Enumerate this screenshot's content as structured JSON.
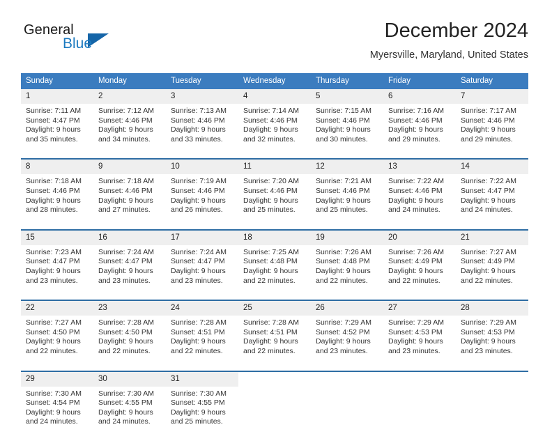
{
  "brand": {
    "name_part1": "General",
    "name_part2": "Blue",
    "logo_icon": "triangle-logo-icon",
    "accent_color": "#1c7ac0"
  },
  "header": {
    "title": "December 2024",
    "subtitle": "Myersville, Maryland, United States"
  },
  "calendar": {
    "header_color": "#3b7cbf",
    "row_border_color": "#2e6da4",
    "daynum_background": "#efefef",
    "weekdays": [
      "Sunday",
      "Monday",
      "Tuesday",
      "Wednesday",
      "Thursday",
      "Friday",
      "Saturday"
    ],
    "weeks": [
      [
        {
          "day": "1",
          "sunrise": "Sunrise: 7:11 AM",
          "sunset": "Sunset: 4:47 PM",
          "daylight1": "Daylight: 9 hours",
          "daylight2": "and 35 minutes."
        },
        {
          "day": "2",
          "sunrise": "Sunrise: 7:12 AM",
          "sunset": "Sunset: 4:46 PM",
          "daylight1": "Daylight: 9 hours",
          "daylight2": "and 34 minutes."
        },
        {
          "day": "3",
          "sunrise": "Sunrise: 7:13 AM",
          "sunset": "Sunset: 4:46 PM",
          "daylight1": "Daylight: 9 hours",
          "daylight2": "and 33 minutes."
        },
        {
          "day": "4",
          "sunrise": "Sunrise: 7:14 AM",
          "sunset": "Sunset: 4:46 PM",
          "daylight1": "Daylight: 9 hours",
          "daylight2": "and 32 minutes."
        },
        {
          "day": "5",
          "sunrise": "Sunrise: 7:15 AM",
          "sunset": "Sunset: 4:46 PM",
          "daylight1": "Daylight: 9 hours",
          "daylight2": "and 30 minutes."
        },
        {
          "day": "6",
          "sunrise": "Sunrise: 7:16 AM",
          "sunset": "Sunset: 4:46 PM",
          "daylight1": "Daylight: 9 hours",
          "daylight2": "and 29 minutes."
        },
        {
          "day": "7",
          "sunrise": "Sunrise: 7:17 AM",
          "sunset": "Sunset: 4:46 PM",
          "daylight1": "Daylight: 9 hours",
          "daylight2": "and 29 minutes."
        }
      ],
      [
        {
          "day": "8",
          "sunrise": "Sunrise: 7:18 AM",
          "sunset": "Sunset: 4:46 PM",
          "daylight1": "Daylight: 9 hours",
          "daylight2": "and 28 minutes."
        },
        {
          "day": "9",
          "sunrise": "Sunrise: 7:18 AM",
          "sunset": "Sunset: 4:46 PM",
          "daylight1": "Daylight: 9 hours",
          "daylight2": "and 27 minutes."
        },
        {
          "day": "10",
          "sunrise": "Sunrise: 7:19 AM",
          "sunset": "Sunset: 4:46 PM",
          "daylight1": "Daylight: 9 hours",
          "daylight2": "and 26 minutes."
        },
        {
          "day": "11",
          "sunrise": "Sunrise: 7:20 AM",
          "sunset": "Sunset: 4:46 PM",
          "daylight1": "Daylight: 9 hours",
          "daylight2": "and 25 minutes."
        },
        {
          "day": "12",
          "sunrise": "Sunrise: 7:21 AM",
          "sunset": "Sunset: 4:46 PM",
          "daylight1": "Daylight: 9 hours",
          "daylight2": "and 25 minutes."
        },
        {
          "day": "13",
          "sunrise": "Sunrise: 7:22 AM",
          "sunset": "Sunset: 4:46 PM",
          "daylight1": "Daylight: 9 hours",
          "daylight2": "and 24 minutes."
        },
        {
          "day": "14",
          "sunrise": "Sunrise: 7:22 AM",
          "sunset": "Sunset: 4:47 PM",
          "daylight1": "Daylight: 9 hours",
          "daylight2": "and 24 minutes."
        }
      ],
      [
        {
          "day": "15",
          "sunrise": "Sunrise: 7:23 AM",
          "sunset": "Sunset: 4:47 PM",
          "daylight1": "Daylight: 9 hours",
          "daylight2": "and 23 minutes."
        },
        {
          "day": "16",
          "sunrise": "Sunrise: 7:24 AM",
          "sunset": "Sunset: 4:47 PM",
          "daylight1": "Daylight: 9 hours",
          "daylight2": "and 23 minutes."
        },
        {
          "day": "17",
          "sunrise": "Sunrise: 7:24 AM",
          "sunset": "Sunset: 4:47 PM",
          "daylight1": "Daylight: 9 hours",
          "daylight2": "and 23 minutes."
        },
        {
          "day": "18",
          "sunrise": "Sunrise: 7:25 AM",
          "sunset": "Sunset: 4:48 PM",
          "daylight1": "Daylight: 9 hours",
          "daylight2": "and 22 minutes."
        },
        {
          "day": "19",
          "sunrise": "Sunrise: 7:26 AM",
          "sunset": "Sunset: 4:48 PM",
          "daylight1": "Daylight: 9 hours",
          "daylight2": "and 22 minutes."
        },
        {
          "day": "20",
          "sunrise": "Sunrise: 7:26 AM",
          "sunset": "Sunset: 4:49 PM",
          "daylight1": "Daylight: 9 hours",
          "daylight2": "and 22 minutes."
        },
        {
          "day": "21",
          "sunrise": "Sunrise: 7:27 AM",
          "sunset": "Sunset: 4:49 PM",
          "daylight1": "Daylight: 9 hours",
          "daylight2": "and 22 minutes."
        }
      ],
      [
        {
          "day": "22",
          "sunrise": "Sunrise: 7:27 AM",
          "sunset": "Sunset: 4:50 PM",
          "daylight1": "Daylight: 9 hours",
          "daylight2": "and 22 minutes."
        },
        {
          "day": "23",
          "sunrise": "Sunrise: 7:28 AM",
          "sunset": "Sunset: 4:50 PM",
          "daylight1": "Daylight: 9 hours",
          "daylight2": "and 22 minutes."
        },
        {
          "day": "24",
          "sunrise": "Sunrise: 7:28 AM",
          "sunset": "Sunset: 4:51 PM",
          "daylight1": "Daylight: 9 hours",
          "daylight2": "and 22 minutes."
        },
        {
          "day": "25",
          "sunrise": "Sunrise: 7:28 AM",
          "sunset": "Sunset: 4:51 PM",
          "daylight1": "Daylight: 9 hours",
          "daylight2": "and 22 minutes."
        },
        {
          "day": "26",
          "sunrise": "Sunrise: 7:29 AM",
          "sunset": "Sunset: 4:52 PM",
          "daylight1": "Daylight: 9 hours",
          "daylight2": "and 23 minutes."
        },
        {
          "day": "27",
          "sunrise": "Sunrise: 7:29 AM",
          "sunset": "Sunset: 4:53 PM",
          "daylight1": "Daylight: 9 hours",
          "daylight2": "and 23 minutes."
        },
        {
          "day": "28",
          "sunrise": "Sunrise: 7:29 AM",
          "sunset": "Sunset: 4:53 PM",
          "daylight1": "Daylight: 9 hours",
          "daylight2": "and 23 minutes."
        }
      ],
      [
        {
          "day": "29",
          "sunrise": "Sunrise: 7:30 AM",
          "sunset": "Sunset: 4:54 PM",
          "daylight1": "Daylight: 9 hours",
          "daylight2": "and 24 minutes."
        },
        {
          "day": "30",
          "sunrise": "Sunrise: 7:30 AM",
          "sunset": "Sunset: 4:55 PM",
          "daylight1": "Daylight: 9 hours",
          "daylight2": "and 24 minutes."
        },
        {
          "day": "31",
          "sunrise": "Sunrise: 7:30 AM",
          "sunset": "Sunset: 4:55 PM",
          "daylight1": "Daylight: 9 hours",
          "daylight2": "and 25 minutes."
        },
        {
          "day": "",
          "sunrise": "",
          "sunset": "",
          "daylight1": "",
          "daylight2": ""
        },
        {
          "day": "",
          "sunrise": "",
          "sunset": "",
          "daylight1": "",
          "daylight2": ""
        },
        {
          "day": "",
          "sunrise": "",
          "sunset": "",
          "daylight1": "",
          "daylight2": ""
        },
        {
          "day": "",
          "sunrise": "",
          "sunset": "",
          "daylight1": "",
          "daylight2": ""
        }
      ]
    ]
  }
}
